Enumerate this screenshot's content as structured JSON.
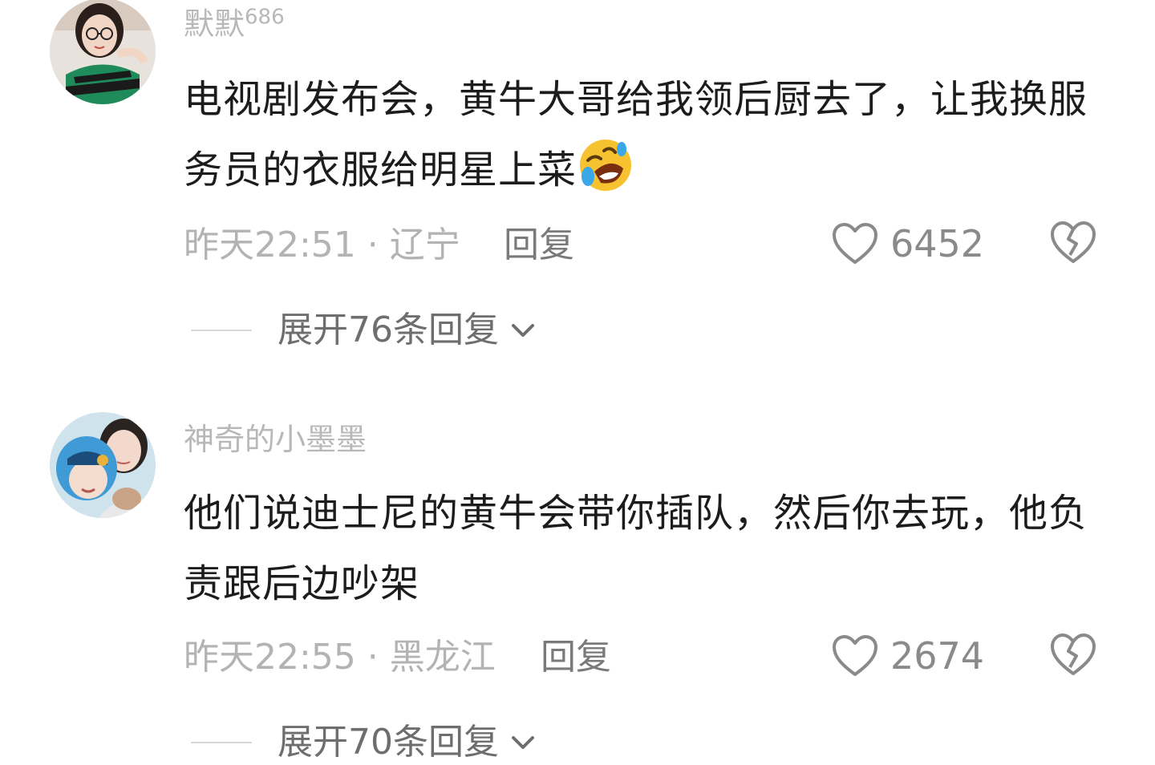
{
  "comments": [
    {
      "username": "默默",
      "username_suffix": "686",
      "avatar_icon": "user-avatar-woman-glasses",
      "content": "电视剧发布会，黄牛大哥给我领后厨去了，让我换服务员的衣服给明星上菜",
      "emoji": "rolling-on-floor-laughing-emoji",
      "time": "昨天22:51",
      "location": "辽宁",
      "separator": " · ",
      "reply_label": "回复",
      "like_count": "6452",
      "expand_label": "展开76条回复"
    },
    {
      "username": "神奇的小墨墨",
      "avatar_icon": "user-avatar-mother-child",
      "content": "他们说迪士尼的黄牛会带你插队，然后你去玩，他负责跟后边吵架",
      "time": "昨天22:55",
      "location": "黑龙江",
      "separator": " · ",
      "reply_label": "回复",
      "like_count": "2674",
      "expand_label": "展开70条回复"
    }
  ],
  "colors": {
    "text": "#1c1c1c",
    "meta": "#b3b3b3",
    "username": "#b8b8b8",
    "action": "#7a7a7a",
    "icon": "#8a8a8a"
  }
}
